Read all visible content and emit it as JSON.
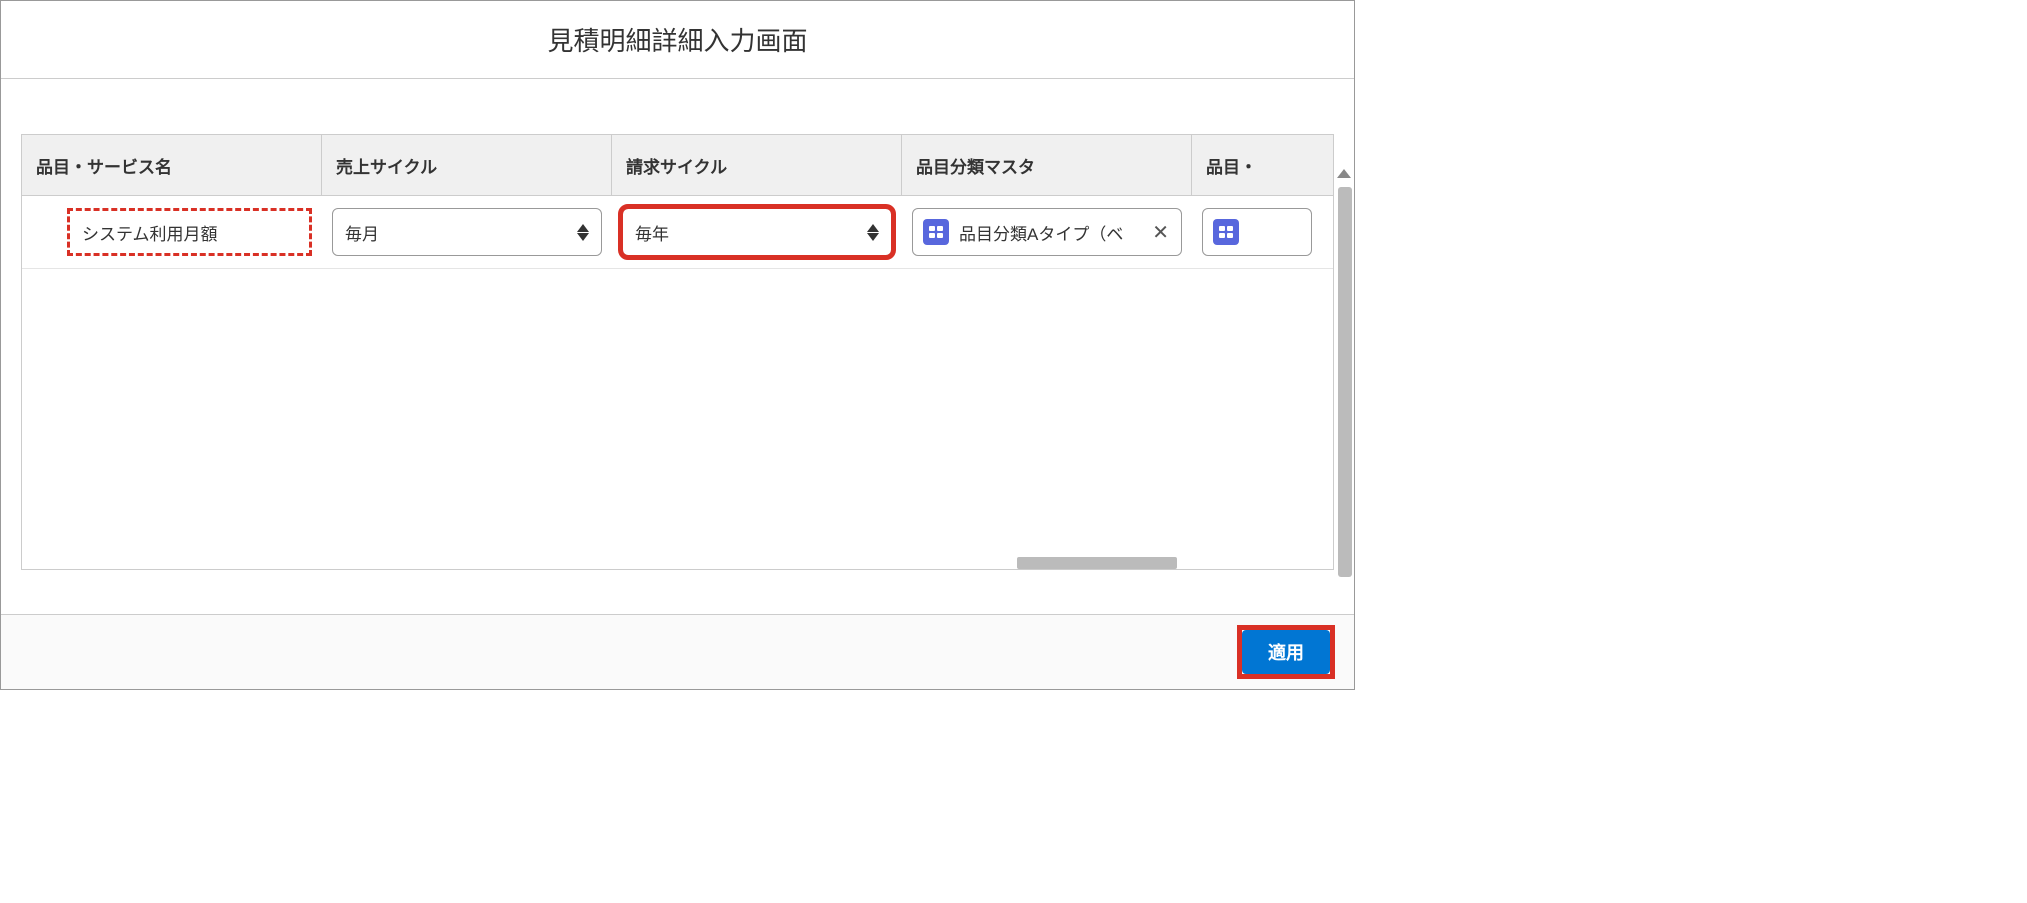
{
  "dialog": {
    "title": "見積明細詳細入力画面"
  },
  "columns": {
    "item_name": "品目・サービス名",
    "sales_cycle": "売上サイクル",
    "billing_cycle": "請求サイクル",
    "category_master": "品目分類マスタ",
    "item_extra": "品目・"
  },
  "row": {
    "item_name": "システム利用月額",
    "sales_cycle": "毎月",
    "billing_cycle": "毎年",
    "category_master": "品目分類Aタイプ（ベ"
  },
  "footer": {
    "apply_label": "適用"
  }
}
